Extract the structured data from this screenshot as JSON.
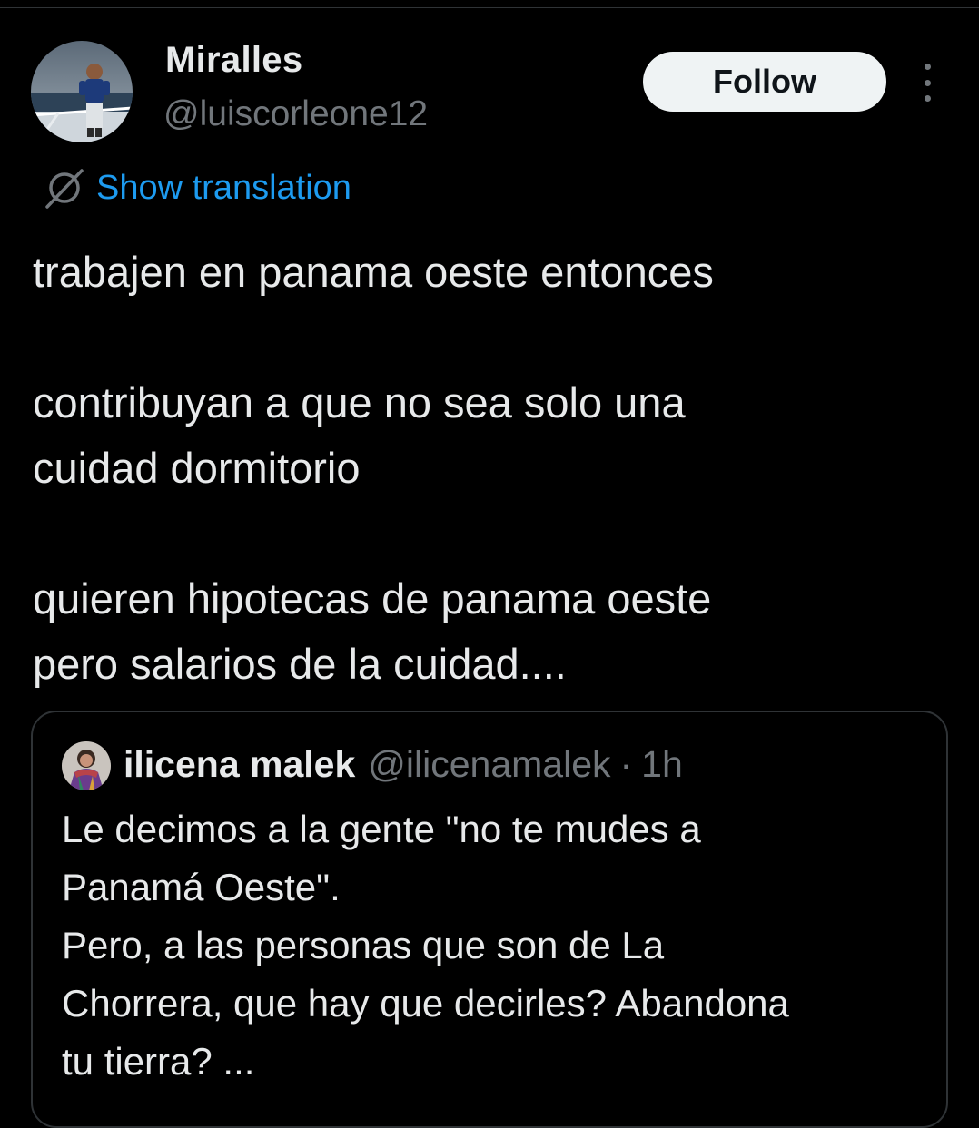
{
  "author": {
    "display_name": "Miralles",
    "handle": "@luiscorleone12",
    "avatar_icon": "profile-photo-man-on-ship-deck"
  },
  "follow_button": {
    "label": "Follow"
  },
  "more_menu": {
    "icon": "more-vertical-icon"
  },
  "translation": {
    "label": "Show translation",
    "icon": "translate-globe-icon"
  },
  "post": {
    "lines": [
      "trabajen en panama oeste entonces",
      "contribuyan a que no sea solo una",
      "cuidad dormitorio",
      "quieren hipotecas de panama oeste",
      "pero salarios de la cuidad...."
    ]
  },
  "quoted_post": {
    "display_name": "ilicena malek",
    "handle": "@ilicenamalek",
    "separator": "·",
    "time": "1h",
    "avatar_icon": "profile-photo-woman",
    "lines": [
      "Le decimos a la gente \"no te mudes a",
      "Panamá Oeste\".",
      "Pero, a las personas que son de La",
      "Chorrera, que hay que decirles? Abandona",
      "tu tierra? ..."
    ]
  },
  "colors": {
    "background": "#000000",
    "text_primary": "#e7e9ea",
    "text_secondary": "#71767b",
    "link_blue": "#1d9bf0",
    "border": "#2f3336",
    "follow_bg": "#eff3f4"
  }
}
